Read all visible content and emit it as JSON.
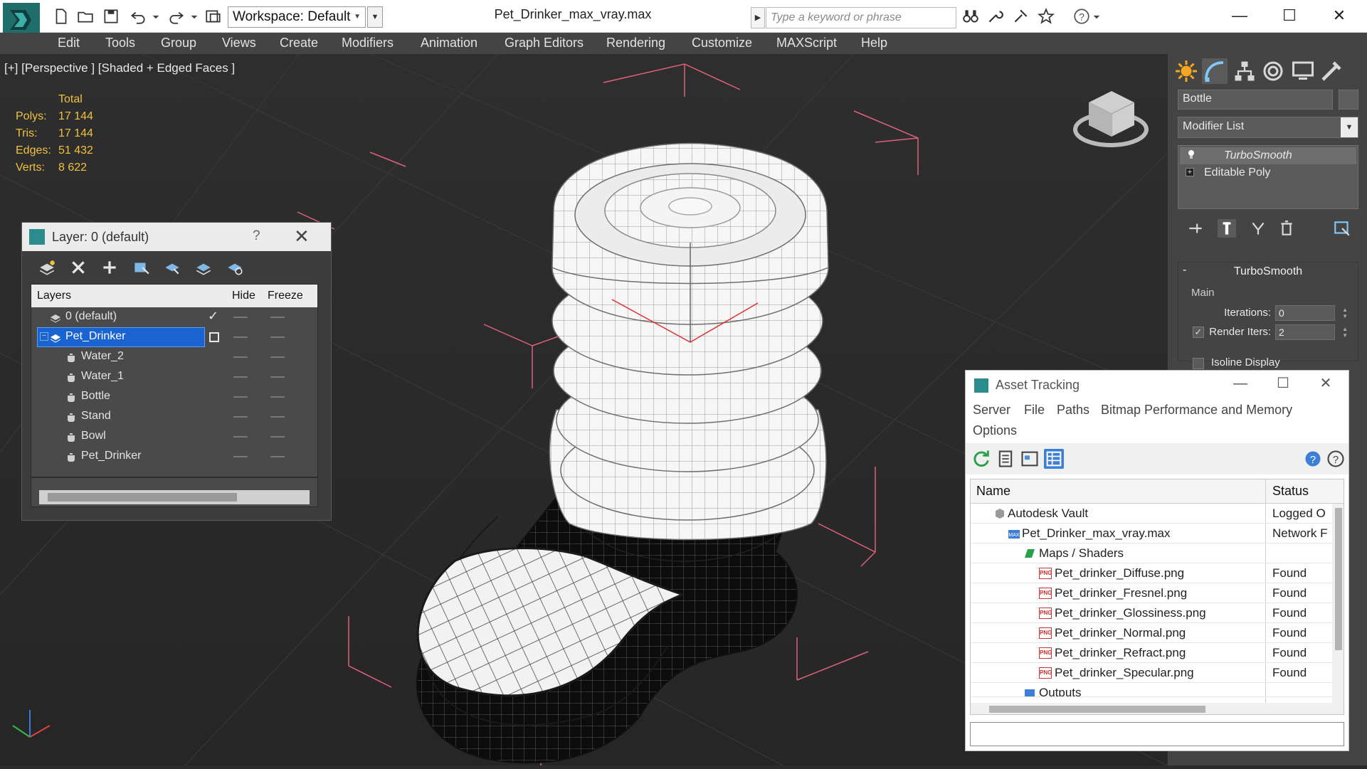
{
  "window": {
    "title": "Pet_Drinker_max_vray.max",
    "workspace_label": "Workspace: Default",
    "search_placeholder": "Type a keyword or phrase",
    "minimize": "—",
    "maximize": "☐",
    "close": "✕"
  },
  "menu": [
    "Edit",
    "Tools",
    "Group",
    "Views",
    "Create",
    "Modifiers",
    "Animation",
    "Graph Editors",
    "Rendering",
    "Customize",
    "MAXScript",
    "Help"
  ],
  "viewport": {
    "label": "[+] [Perspective ] [Shaded + Edged Faces ]",
    "stats": {
      "header": "Total",
      "rows": [
        {
          "label": "Polys:",
          "value": "17 144"
        },
        {
          "label": "Tris:",
          "value": "17 144"
        },
        {
          "label": "Edges:",
          "value": "51 432"
        },
        {
          "label": "Verts:",
          "value": "8 622"
        }
      ]
    }
  },
  "layer_dialog": {
    "title": "Layer: 0 (default)",
    "help": "?",
    "close": "✕",
    "columns": {
      "layers": "Layers",
      "hide": "Hide",
      "freeze": "Freeze"
    },
    "rows": [
      {
        "name": "0 (default)",
        "kind": "layer",
        "checked": true
      },
      {
        "name": "Pet_Drinker",
        "kind": "layer",
        "selected": true
      },
      {
        "name": "Water_2",
        "kind": "object"
      },
      {
        "name": "Water_1",
        "kind": "object"
      },
      {
        "name": "Bottle",
        "kind": "object"
      },
      {
        "name": "Stand",
        "kind": "object"
      },
      {
        "name": "Bowl",
        "kind": "object"
      },
      {
        "name": "Pet_Drinker",
        "kind": "object"
      }
    ]
  },
  "command_panel": {
    "object_name": "Bottle",
    "modifier_list": "Modifier List",
    "stack": [
      {
        "label": "TurboSmooth",
        "active": true
      },
      {
        "label": "Editable Poly",
        "active": false
      }
    ],
    "turbosmooth": {
      "title": "TurboSmooth",
      "minus": "-",
      "main_label": "Main",
      "iterations_label": "Iterations:",
      "iterations_value": "0",
      "render_iters_label": "Render Iters:",
      "render_iters_value": "2",
      "isoline_label": "Isoline Display"
    }
  },
  "asset_tracking": {
    "title": "Asset Tracking",
    "minimize": "—",
    "maximize": "☐",
    "close": "✕",
    "menu": [
      "Server",
      "File",
      "Paths",
      "Bitmap Performance and Memory",
      "Options"
    ],
    "columns": {
      "name": "Name",
      "status": "Status"
    },
    "rows": [
      {
        "name": "Autodesk Vault",
        "status": "Logged O",
        "indent": 1,
        "icon": "vault-icon"
      },
      {
        "name": "Pet_Drinker_max_vray.max",
        "status": "Network F",
        "indent": 2,
        "icon": "max-file-icon"
      },
      {
        "name": "Maps / Shaders",
        "status": "",
        "indent": 3,
        "icon": "maps-folder-icon"
      },
      {
        "name": "Pet_drinker_Diffuse.png",
        "status": "Found",
        "indent": 4,
        "icon": "png-icon"
      },
      {
        "name": "Pet_drinker_Fresnel.png",
        "status": "Found",
        "indent": 4,
        "icon": "png-icon"
      },
      {
        "name": "Pet_drinker_Glossiness.png",
        "status": "Found",
        "indent": 4,
        "icon": "png-icon"
      },
      {
        "name": "Pet_drinker_Normal.png",
        "status": "Found",
        "indent": 4,
        "icon": "png-icon"
      },
      {
        "name": "Pet_drinker_Refract.png",
        "status": "Found",
        "indent": 4,
        "icon": "png-icon"
      },
      {
        "name": "Pet_drinker_Specular.png",
        "status": "Found",
        "indent": 4,
        "icon": "png-icon"
      },
      {
        "name": "Outputs",
        "status": "",
        "indent": 3,
        "icon": "outputs-icon"
      }
    ]
  },
  "colors": {
    "selection": "#1a64d1",
    "stats": "#f0c040",
    "bbox": "#e0607a",
    "logo": "#2a8c8c"
  }
}
